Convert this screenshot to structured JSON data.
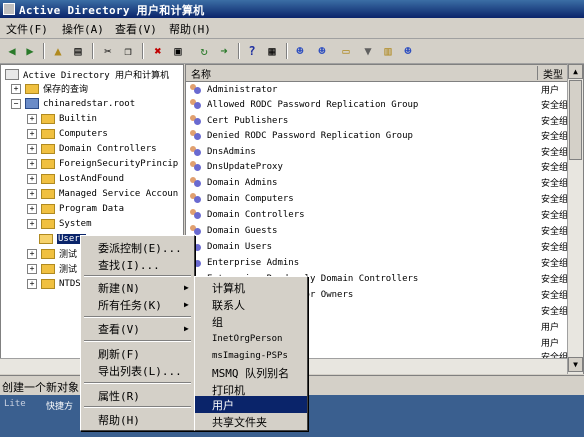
{
  "window": {
    "title": "Active Directory 用户和计算机"
  },
  "menubar": [
    "文件(F)",
    "操作(A)",
    "查看(V)",
    "帮助(H)"
  ],
  "toolbar_icons": [
    "back-icon",
    "forward-icon",
    "up-icon",
    "show-tree-icon",
    "cut-icon",
    "copy-icon",
    "delete-icon",
    "properties-icon",
    "refresh-icon",
    "export-icon",
    "help-icon",
    "console-icon",
    "new-user-icon",
    "new-group-icon",
    "new-ou-icon",
    "filter-icon",
    "find-icon",
    "add-to-group-icon"
  ],
  "tree": {
    "root": "Active Directory 用户和计算机",
    "saved": "保存的查询",
    "domain": "chinaredstar.root",
    "children": [
      "Builtin",
      "Computers",
      "Domain Controllers",
      "ForeignSecurityPrincip",
      "LostAndFound",
      "Managed Service Accoun",
      "Program Data",
      "System",
      "Users",
      "测试",
      "测试",
      "NTDS"
    ]
  },
  "list": {
    "headers": {
      "name": "名称",
      "type": "类型"
    },
    "rows": [
      {
        "name": "Administrator",
        "type": "用户"
      },
      {
        "name": "Allowed RODC Password Replication Group",
        "type": "安全组"
      },
      {
        "name": "Cert Publishers",
        "type": "安全组"
      },
      {
        "name": "Denied RODC Password Replication Group",
        "type": "安全组"
      },
      {
        "name": "DnsAdmins",
        "type": "安全组"
      },
      {
        "name": "DnsUpdateProxy",
        "type": "安全组"
      },
      {
        "name": "Domain Admins",
        "type": "安全组"
      },
      {
        "name": "Domain Computers",
        "type": "安全组"
      },
      {
        "name": "Domain Controllers",
        "type": "安全组"
      },
      {
        "name": "Domain Guests",
        "type": "安全组"
      },
      {
        "name": "Domain Users",
        "type": "安全组"
      },
      {
        "name": "Enterprise Admins",
        "type": "安全组"
      },
      {
        "name": "Enterprise Read-only Domain Controllers",
        "type": "安全组"
      },
      {
        "name": "Group Policy Creator Owners",
        "type": "安全组"
      },
      {
        "name": "",
        "type": "安全组"
      },
      {
        "name": "",
        "type": "用户"
      },
      {
        "name": "",
        "type": "用户"
      },
      {
        "name": "",
        "type": "安全组"
      },
      {
        "name": "",
        "type": "安全组"
      }
    ]
  },
  "status": "创建一个新对象",
  "taskbar": {
    "left": "Lite",
    "right": "快捷方"
  },
  "context_menu": {
    "items": [
      "委派控制(E)...",
      "查找(I)...",
      "新建(N)",
      "所有任务(K)",
      "查看(V)",
      "刷新(F)",
      "导出列表(L)...",
      "属性(R)",
      "帮助(H)"
    ]
  },
  "submenu": {
    "items": [
      "计算机",
      "联系人",
      "组",
      "InetOrgPerson",
      "msImaging-PSPs",
      "MSMQ 队列别名",
      "打印机",
      "用户",
      "共享文件夹"
    ],
    "highlighted_index": 7
  }
}
